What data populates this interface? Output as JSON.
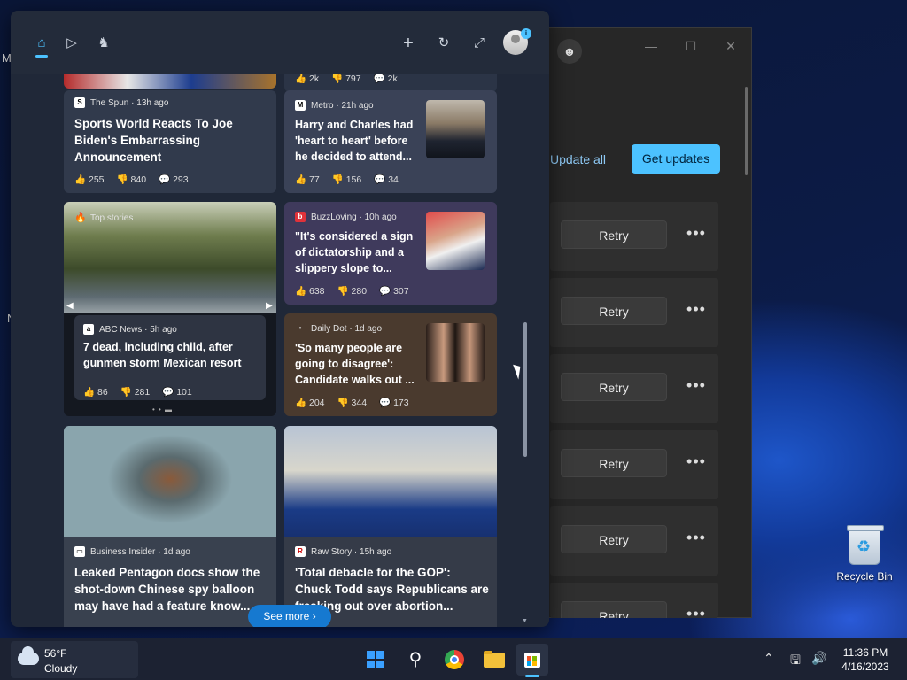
{
  "desktop": {
    "left_edge_letters": [
      "M",
      "N"
    ],
    "recycle_bin_label": "Recycle Bin"
  },
  "store_window": {
    "update_all_label": "Update all",
    "get_updates_label": "Get updates",
    "rows": [
      {
        "retry_label": "Retry",
        "more_label": "•••"
      },
      {
        "retry_label": "Retry",
        "more_label": "•••"
      },
      {
        "retry_label": "Retry",
        "more_label": "•••"
      },
      {
        "retry_label": "Retry",
        "more_label": "•••"
      },
      {
        "retry_label": "Retry",
        "more_label": "•••"
      },
      {
        "retry_label": "Retry",
        "more_label": "•••"
      }
    ],
    "controls": {
      "minimize": "—",
      "maximize": "☐",
      "close": "✕"
    }
  },
  "widgets": {
    "toolbar_icons": [
      "home-icon",
      "video-icon",
      "games-icon",
      "add-icon",
      "refresh-icon",
      "expand-icon",
      "avatar"
    ],
    "badge": "i",
    "top_partial_card_stats": {
      "likes": "2k",
      "dislikes": "797",
      "comments": "2k"
    },
    "cards": [
      {
        "source": "The Spun · 13h ago",
        "logo": "S",
        "title": "Sports World Reacts To Joe Biden's Embarrassing Announcement",
        "likes": "255",
        "dislikes": "840",
        "comments": "293"
      },
      {
        "source": "Metro · 21h ago",
        "logo": "M",
        "title": "Harry and Charles had 'heart to heart' before he decided to attend...",
        "likes": "77",
        "dislikes": "156",
        "comments": "34"
      },
      {
        "source": "Top stories",
        "logo": "🔥",
        "headline_source": "ABC News · 5h ago",
        "title": "7 dead, including child, after gunmen storm Mexican resort",
        "likes": "86",
        "dislikes": "281",
        "comments": "101"
      },
      {
        "source": "BuzzLoving · 10h ago",
        "logo": "b",
        "title": "\"It's considered a sign of dictatorship and a slippery slope to...",
        "likes": "638",
        "dislikes": "280",
        "comments": "307"
      },
      {
        "source": "Daily Dot · 1d ago",
        "logo": "•",
        "title": "'So many people are going to disagree': Candidate walks out ...",
        "likes": "204",
        "dislikes": "344",
        "comments": "173"
      },
      {
        "source": "Business Insider · 1d ago",
        "logo": "▭",
        "title": "Leaked Pentagon docs show the shot-down Chinese spy balloon may have had a feature know...",
        "likes": "",
        "dislikes": "",
        "comments": ""
      },
      {
        "source": "Raw Story · 15h ago",
        "logo": "R",
        "title": "'Total debacle for the GOP': Chuck Todd says Republicans are freaking out over abortion...",
        "likes": "",
        "dislikes": "",
        "comments": ""
      }
    ],
    "see_more_label": "See more",
    "see_more_chevron": "›"
  },
  "taskbar": {
    "weather": {
      "temp": "56°F",
      "condition": "Cloudy"
    },
    "apps": [
      "start",
      "search",
      "chrome",
      "file-explorer",
      "microsoft-store"
    ],
    "clock": {
      "time": "11:36 PM",
      "date": "4/16/2023"
    }
  }
}
